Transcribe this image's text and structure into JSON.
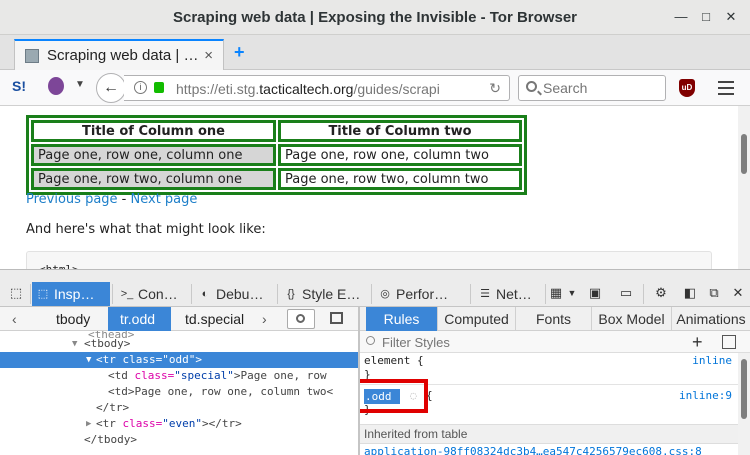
{
  "window": {
    "title": "Scraping web data | Exposing the Invisible - Tor Browser"
  },
  "tab": {
    "title": "Scraping web data | …",
    "close": "×",
    "new_tab": "+"
  },
  "navbar": {
    "url_prefix": "https://eti.stg.",
    "url_domain": "tacticaltech.org",
    "url_suffix": "/guides/scrapi",
    "search_placeholder": "Search",
    "ublock_label": "uD"
  },
  "page": {
    "table": {
      "headers": [
        "Title of Column one",
        "Title of Column two"
      ],
      "rows": [
        [
          "Page one, row one, column one",
          "Page one, row one, column two"
        ],
        [
          "Page one, row two, column one",
          "Page one, row two, column two"
        ]
      ]
    },
    "prev_link": "Previous page",
    "sep": " - ",
    "next_link": "Next page",
    "prose": "And here's what that might look like:",
    "code": "<html>"
  },
  "devtools": {
    "tabs": [
      "Insp…",
      "Con…",
      "Debu…",
      "Style E…",
      "Perfor…",
      "Net…"
    ],
    "breadcrumbs": [
      "tbody",
      "tr.odd",
      "td.special"
    ],
    "markup": {
      "line0": "<thead>",
      "line1_tag": "<tbody>",
      "line2_open": "<tr ",
      "line2_attr": "class=",
      "line2_val": "\"odd\"",
      "line2_close": ">",
      "line3_open": "<td ",
      "line3_attr": "class=",
      "line3_val": "\"special\"",
      "line3_text": ">Page one, row",
      "line4": "<td>Page one, row one, column two<",
      "line5": "</tr>",
      "line6_open": "<tr ",
      "line6_attr": "class=",
      "line6_val": "\"even\"",
      "line6_close": "></tr>",
      "line7": "</tbody>"
    },
    "rules_tabs": [
      "Rules",
      "Computed",
      "Fonts",
      "Box Model",
      "Animations"
    ],
    "filter_placeholder": "Filter Styles",
    "rules": {
      "element_selector": "element {",
      "element_close": "}",
      "element_source": "inline",
      "odd_selector": ".odd",
      "odd_open": "{",
      "odd_close": "}",
      "odd_source": "inline:9",
      "inherited_label": "Inherited from table",
      "inherited_source": "application-98ff08324dc3b4…ea547c4256579ec608.css:8"
    }
  },
  "colors": {
    "accent": "#3b86d7",
    "table_border": "#1a7f1a",
    "highlight_box": "#e00000"
  }
}
